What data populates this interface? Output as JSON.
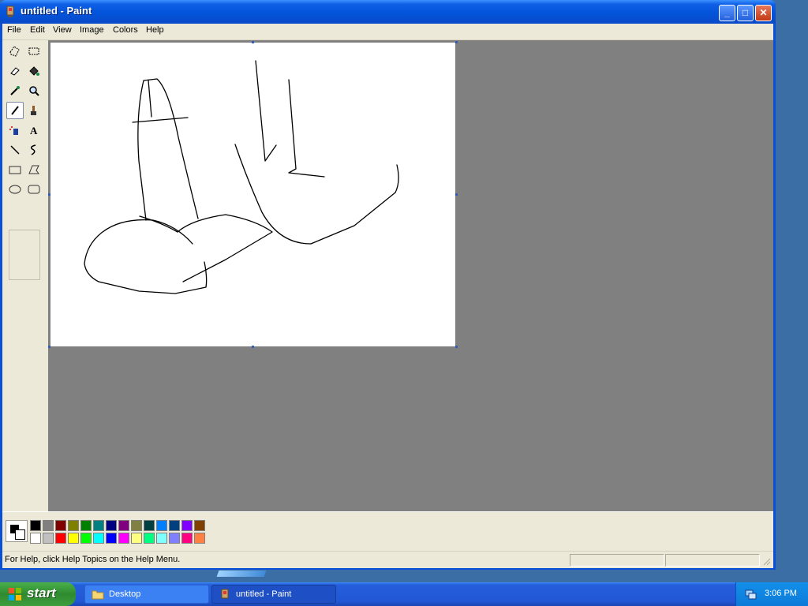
{
  "window": {
    "title": "untitled - Paint",
    "controls": {
      "minimize": "_",
      "maximize": "□",
      "close": "✕"
    }
  },
  "menu": [
    "File",
    "Edit",
    "View",
    "Image",
    "Colors",
    "Help"
  ],
  "tools": [
    "free-form-select",
    "select",
    "eraser",
    "fill-with-color",
    "pick-color",
    "magnifier",
    "pencil",
    "brush",
    "airbrush",
    "text",
    "line",
    "curve",
    "rectangle",
    "polygon",
    "ellipse",
    "rounded-rectangle"
  ],
  "active_tool": "pencil",
  "colors": {
    "foreground": "#000000",
    "background": "#ffffff",
    "palette_top": [
      "#000000",
      "#808080",
      "#800000",
      "#808000",
      "#008000",
      "#008080",
      "#000080",
      "#800080",
      "#808040",
      "#004040",
      "#0080ff",
      "#004080",
      "#8000ff",
      "#804000"
    ],
    "palette_bottom": [
      "#ffffff",
      "#c0c0c0",
      "#ff0000",
      "#ffff00",
      "#00ff00",
      "#00ffff",
      "#0000ff",
      "#ff00ff",
      "#ffff80",
      "#00ff80",
      "#80ffff",
      "#8080ff",
      "#ff0080",
      "#ff8040"
    ]
  },
  "status": {
    "help_text": "For Help, click Help Topics on the Help Menu."
  },
  "taskbar": {
    "start_label": "start",
    "buttons": [
      "Desktop",
      "untitled - Paint"
    ],
    "clock": "3:06 PM"
  }
}
